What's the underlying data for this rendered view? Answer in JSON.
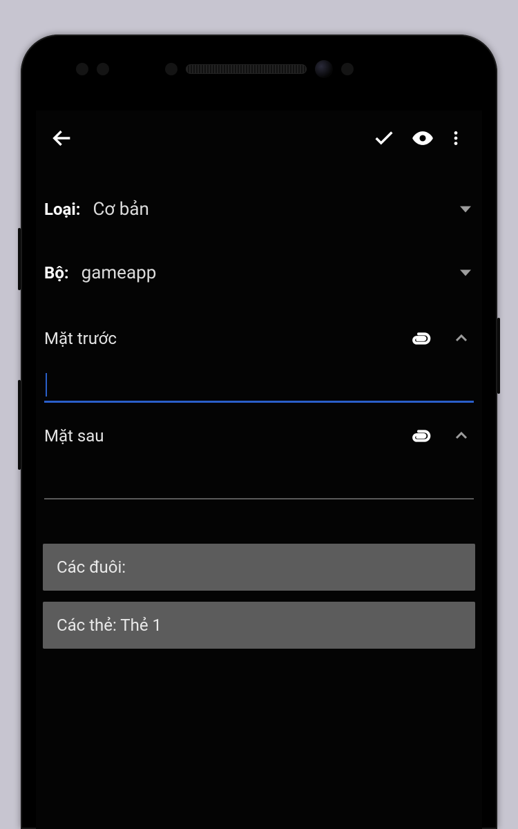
{
  "type_row": {
    "label": "Loại:",
    "value": "Cơ bản"
  },
  "deck_row": {
    "label": "Bộ:",
    "value": "gameapp"
  },
  "front": {
    "label": "Mặt trước",
    "value": ""
  },
  "back": {
    "label": "Mặt sau",
    "value": ""
  },
  "tags_chip": "Các đuôi:",
  "cards_chip": "Các thẻ: Thẻ 1"
}
